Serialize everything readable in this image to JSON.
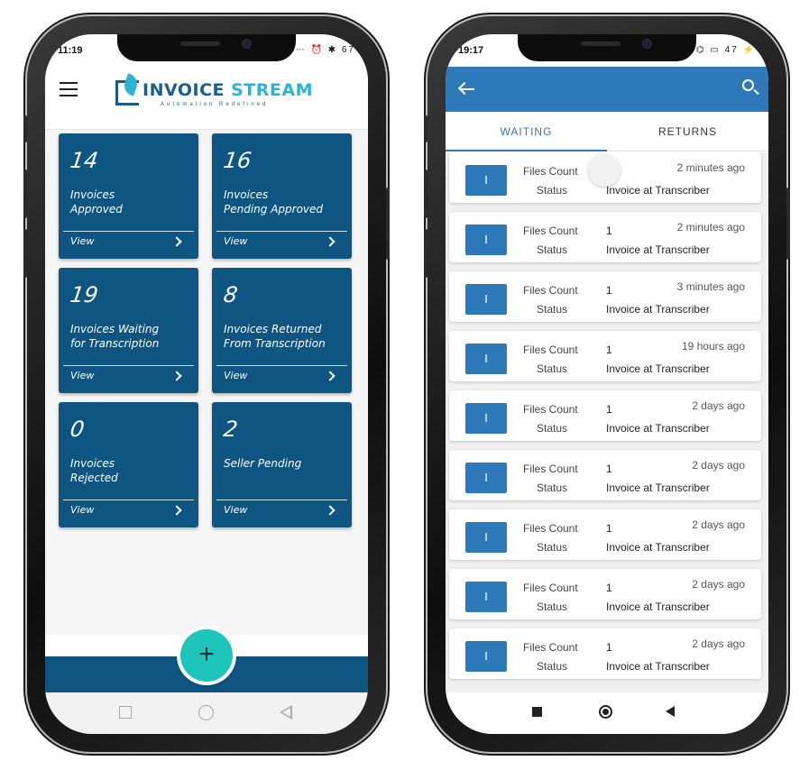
{
  "left_phone": {
    "status": {
      "time": "11:19",
      "icons": "⋯ ⏰ ✱ 67"
    },
    "header": {
      "menu_icon": "hamburger-icon",
      "logo_text_a": "INVOICE ",
      "logo_text_b": "STREAM",
      "logo_sub": "Automation Redefined"
    },
    "cards": [
      {
        "number": "14",
        "label": "Invoices\nApproved",
        "view": "View"
      },
      {
        "number": "16",
        "label": "Invoices\nPending Approved",
        "view": "View"
      },
      {
        "number": "19",
        "label": "Invoices Waiting\nfor Transcription",
        "view": "View"
      },
      {
        "number": "8",
        "label": "Invoices Returned\nFrom Transcription",
        "view": "View"
      },
      {
        "number": "0",
        "label": "Invoices\nRejected",
        "view": "View"
      },
      {
        "number": "2",
        "label": "Seller Pending",
        "view": "View"
      }
    ],
    "fab_label": "+",
    "colors": {
      "card": "#0e5582",
      "fab": "#1dc5bb",
      "brand": "#1b5f92"
    }
  },
  "right_phone": {
    "status": {
      "time": "19:17",
      "icons": "⌬ ▭ 47 ⚡"
    },
    "appbar": {
      "back_icon": "arrow-back-icon",
      "search_icon": "search-icon"
    },
    "tabs": [
      {
        "label": "WAITING",
        "active": true
      },
      {
        "label": "RETURNS",
        "active": false
      }
    ],
    "rows": [
      {
        "tag": "I",
        "files_label": "Files Count",
        "files_value": "",
        "status_label": "Status",
        "status_value": "Invoice at Transcriber",
        "time": "2 minutes ago"
      },
      {
        "tag": "I",
        "files_label": "Files Count",
        "files_value": "1",
        "status_label": "Status",
        "status_value": "Invoice at Transcriber",
        "time": "2 minutes ago"
      },
      {
        "tag": "I",
        "files_label": "Files Count",
        "files_value": "1",
        "status_label": "Status",
        "status_value": "Invoice at Transcriber",
        "time": "3 minutes ago"
      },
      {
        "tag": "I",
        "files_label": "Files Count",
        "files_value": "1",
        "status_label": "Status",
        "status_value": "Invoice at Transcriber",
        "time": "19 hours ago"
      },
      {
        "tag": "I",
        "files_label": "Files Count",
        "files_value": "1",
        "status_label": "Status",
        "status_value": "Invoice at Transcriber",
        "time": "2 days ago"
      },
      {
        "tag": "I",
        "files_label": "Files Count",
        "files_value": "1",
        "status_label": "Status",
        "status_value": "Invoice at Transcriber",
        "time": "2 days ago"
      },
      {
        "tag": "I",
        "files_label": "Files Count",
        "files_value": "1",
        "status_label": "Status",
        "status_value": "Invoice at Transcriber",
        "time": "2 days ago"
      },
      {
        "tag": "I",
        "files_label": "Files Count",
        "files_value": "1",
        "status_label": "Status",
        "status_value": "Invoice at Transcriber",
        "time": "2 days ago"
      },
      {
        "tag": "I",
        "files_label": "Files Count",
        "files_value": "1",
        "status_label": "Status",
        "status_value": "Invoice at Transcriber",
        "time": "2 days ago"
      }
    ],
    "colors": {
      "appbar": "#2e79b9",
      "tag": "#2e79b9"
    }
  }
}
